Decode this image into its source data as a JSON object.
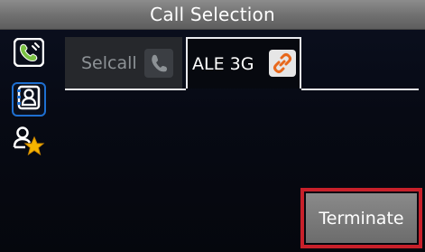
{
  "window": {
    "title": "Call Selection"
  },
  "sidebar": {
    "items": [
      {
        "name": "call-selection",
        "icon": "call-selection-icon",
        "selected": false
      },
      {
        "name": "contacts",
        "icon": "contact-icon",
        "selected": true
      },
      {
        "name": "favorites",
        "icon": "favorite-contact-icon",
        "selected": false
      }
    ]
  },
  "tabs": [
    {
      "label": "Selcall",
      "icon": "phone-handset-icon",
      "active": false
    },
    {
      "label": "ALE 3G",
      "icon": "link-icon",
      "active": true
    }
  ],
  "actions": {
    "terminate_label": "Terminate"
  },
  "colors": {
    "highlight": "#c8202a",
    "accent": "#1e6fd0",
    "favorite_star": "#f5b400",
    "link_icon": "#e8681c"
  }
}
